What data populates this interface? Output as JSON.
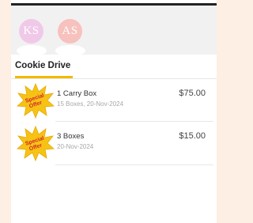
{
  "avatars": [
    {
      "initials": "KS",
      "color": "#f1c9e8"
    },
    {
      "initials": "AS",
      "color": "#f7c1bd"
    }
  ],
  "tab": {
    "label": "Cookie Drive",
    "accent": "#f3b900"
  },
  "badge": {
    "line1": "Special",
    "line2": "Offer",
    "color": "#f6c315"
  },
  "orders": [
    {
      "title": "1 Carry Box",
      "subtitle": "15 Boxes, 20-Nov-2024",
      "price": "$75.00"
    },
    {
      "title": "3 Boxes",
      "subtitle": "20-Nov-2024",
      "price": "$15.00"
    }
  ]
}
